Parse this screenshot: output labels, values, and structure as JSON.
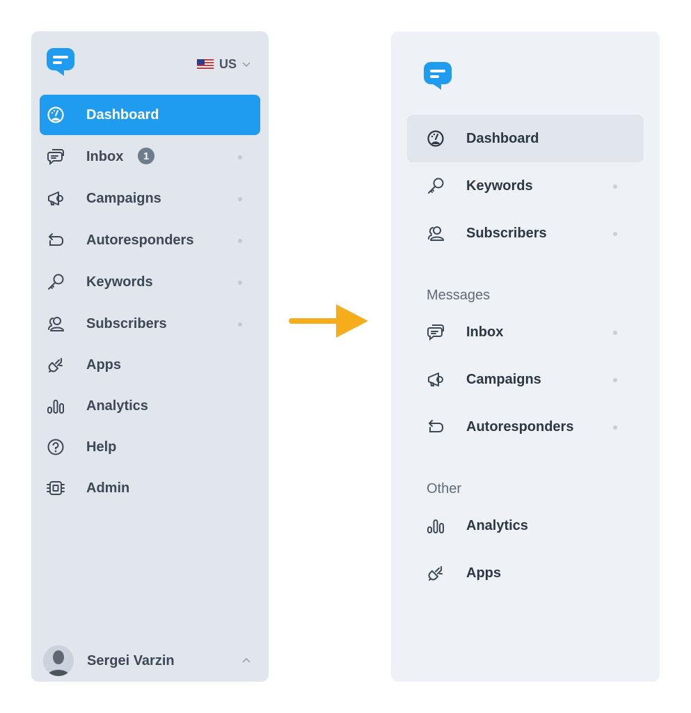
{
  "colors": {
    "brand": "#1f9bef",
    "active_left_bg": "#1f9bef",
    "active_right_bg": "#e1e6ed",
    "arrow": "#f5ad1b",
    "panel_left_bg": "#e1e6ed",
    "panel_right_bg": "#eef1f5"
  },
  "before": {
    "logo_icon": "chat-bubble-logo-icon",
    "locale": {
      "label": "US",
      "flag_icon": "us-flag-icon",
      "chevron_icon": "chevron-down-icon"
    },
    "nav": [
      {
        "label": "Dashboard",
        "icon": "speedometer-icon",
        "active": true,
        "dot": false
      },
      {
        "label": "Inbox",
        "icon": "chat-icon",
        "badge": "1",
        "dot": true
      },
      {
        "label": "Campaigns",
        "icon": "megaphone-icon",
        "dot": true
      },
      {
        "label": "Autoresponders",
        "icon": "reply-arrows-icon",
        "dot": true
      },
      {
        "label": "Keywords",
        "icon": "key-icon",
        "dot": true
      },
      {
        "label": "Subscribers",
        "icon": "users-icon",
        "dot": true
      },
      {
        "label": "Apps",
        "icon": "plug-icon",
        "dot": false
      },
      {
        "label": "Analytics",
        "icon": "bar-chart-icon",
        "dot": false
      },
      {
        "label": "Help",
        "icon": "question-circle-icon",
        "dot": false
      },
      {
        "label": "Admin",
        "icon": "chip-icon",
        "dot": false
      }
    ],
    "user": {
      "name": "Sergei Varzin",
      "avatar_icon": "user-avatar",
      "chevron_icon": "chevron-up-icon"
    }
  },
  "transition_arrow_icon": "right-arrow-icon",
  "after": {
    "logo_icon": "chat-bubble-logo-icon",
    "nav_top": [
      {
        "label": "Dashboard",
        "icon": "speedometer-icon",
        "active": true,
        "dot": false
      },
      {
        "label": "Keywords",
        "icon": "key-icon",
        "dot": true
      },
      {
        "label": "Subscribers",
        "icon": "users-icon",
        "dot": true
      }
    ],
    "sections": [
      {
        "heading": "Messages",
        "items": [
          {
            "label": "Inbox",
            "icon": "chat-icon",
            "dot": true
          },
          {
            "label": "Campaigns",
            "icon": "megaphone-icon",
            "dot": true
          },
          {
            "label": "Autoresponders",
            "icon": "reply-arrows-icon",
            "dot": true
          }
        ]
      },
      {
        "heading": "Other",
        "items": [
          {
            "label": "Analytics",
            "icon": "bar-chart-icon",
            "dot": false
          },
          {
            "label": "Apps",
            "icon": "plug-icon",
            "dot": false
          }
        ]
      }
    ]
  }
}
